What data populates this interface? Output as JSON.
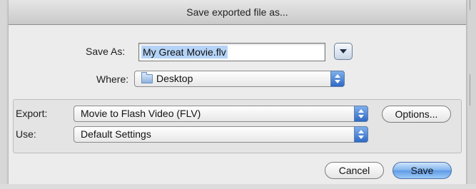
{
  "dialog": {
    "title": "Save exported file as..."
  },
  "save_as": {
    "label": "Save As:",
    "value": "My Great Movie.flv"
  },
  "where": {
    "label": "Where:",
    "value": "Desktop",
    "icon": "folder-icon"
  },
  "export": {
    "label": "Export:",
    "value": "Movie to Flash Video (FLV)"
  },
  "use": {
    "label": "Use:",
    "value": "Default Settings"
  },
  "buttons": {
    "options": "Options...",
    "cancel": "Cancel",
    "save": "Save"
  },
  "colors": {
    "accent": "#5f9ae6",
    "selection": "#b4d3f6"
  }
}
